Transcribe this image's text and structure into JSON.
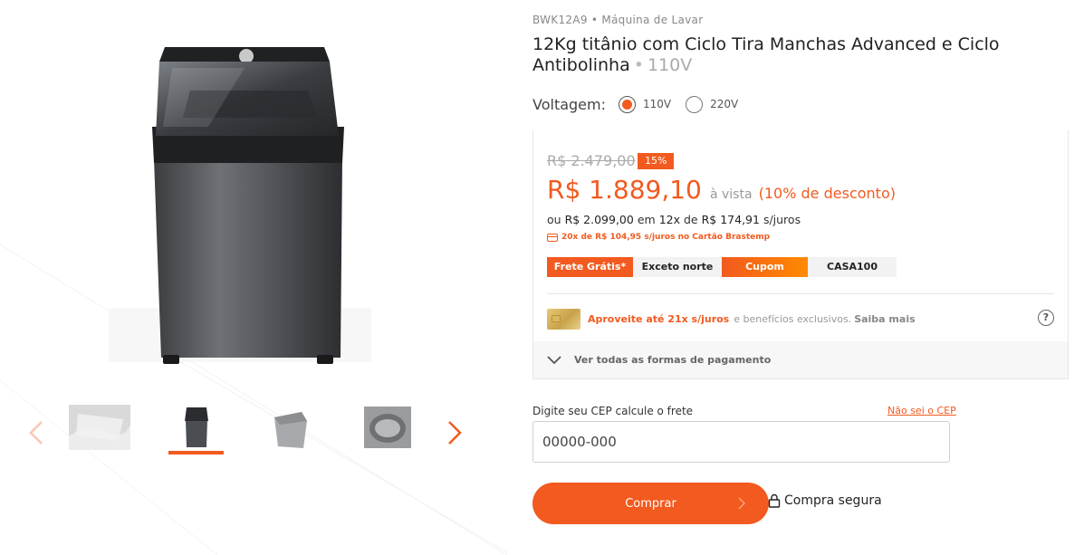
{
  "gallery": {
    "main_image_alt": "Máquina de lavar Brastemp titânio",
    "prev_icon": "chevron-left-icon",
    "next_icon": "chevron-right-icon",
    "thumbnails": [
      "washer-detail",
      "washer-front",
      "washer-side",
      "washer-top-open"
    ],
    "active_thumbnail": 1
  },
  "product": {
    "ref": "BWK12A9 • Máquina de Lavar",
    "title": "12Kg titânio com Ciclo Tira Manchas Advanced e Ciclo Antibolinha",
    "title_sep": "•",
    "title_voltage": "110V"
  },
  "voltage": {
    "label": "Voltagem:",
    "options": [
      {
        "label": "110V",
        "selected": true
      },
      {
        "label": "220V",
        "selected": false
      }
    ]
  },
  "pricing": {
    "old_price": "R$ 2.479,00",
    "discount_badge": "15%",
    "price": "R$ 1.889,10",
    "cash_label": "à vista",
    "cash_discount": "(10% de desconto)",
    "installment_prefix": "ou",
    "installment_total": "R$ 2.099,00",
    "installment_mid": "em",
    "installment_count": "12x",
    "installment_of": "de",
    "installment_value": "R$ 174,91",
    "installment_suffix": "s/juros",
    "card_offer": "20x de R$ 104,95 s/juros no Cartão Brastemp"
  },
  "tags": [
    {
      "label": "Frete Grátis*",
      "style": "orange"
    },
    {
      "label": "Exceto norte",
      "style": "grey"
    },
    {
      "label": "Cupom",
      "style": "orange"
    },
    {
      "label": "CASA100",
      "style": "grey"
    }
  ],
  "card_promo": {
    "strong": "Aproveite até 21x s/juros",
    "rest": "e benefícios exclusivos.",
    "link": "Saiba mais",
    "help": "?"
  },
  "payment_toggle": {
    "label": "Ver todas as formas de pagamento"
  },
  "cep": {
    "label": "Digite seu CEP calcule o frete",
    "link": "Não sei o CEP",
    "placeholder": "00000-000"
  },
  "buy": {
    "label": "Comprar",
    "secure_label": "Compra segura"
  },
  "colors": {
    "accent": "#f25a1f"
  }
}
